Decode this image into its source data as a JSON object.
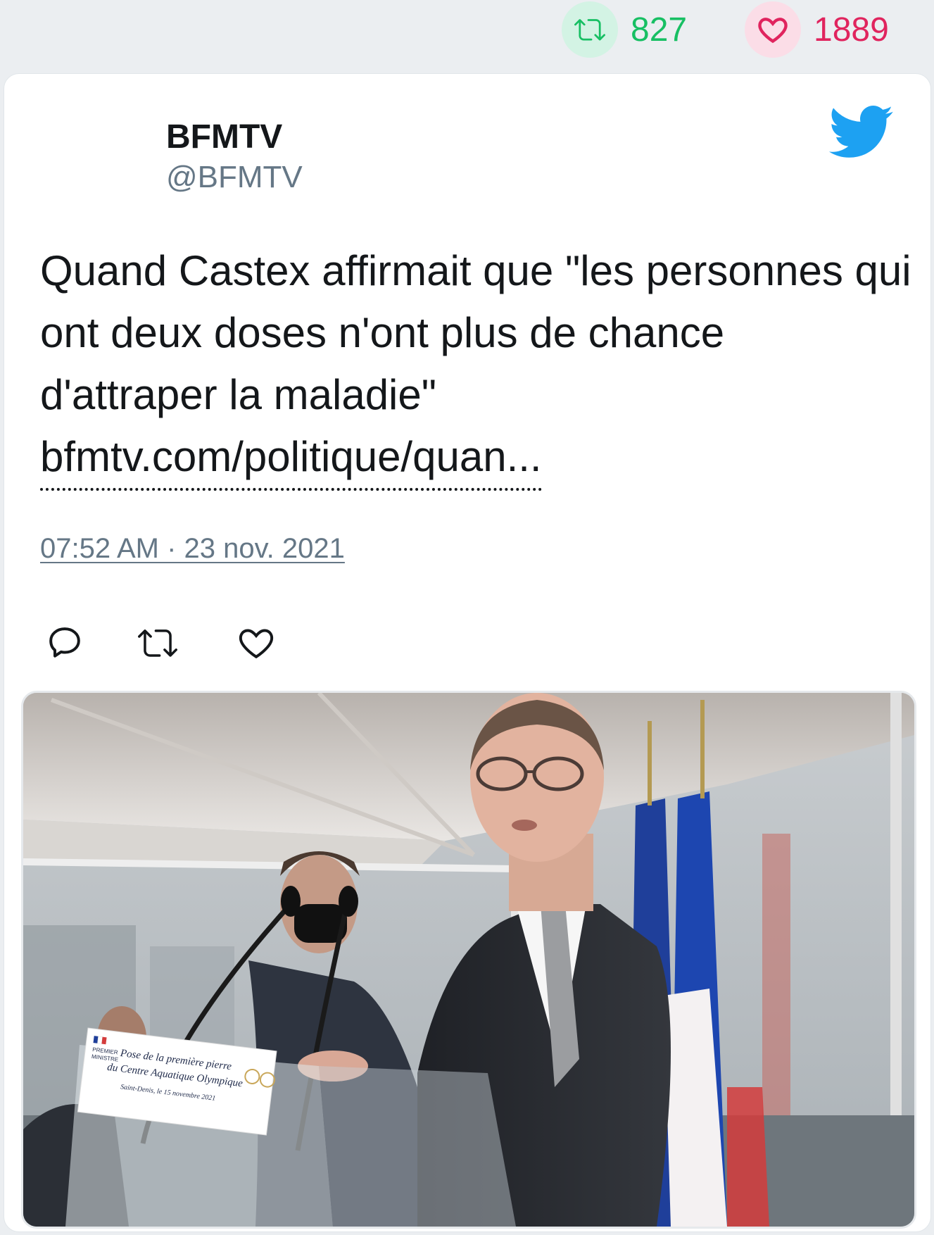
{
  "stats": {
    "retweets": "827",
    "likes": "1889",
    "retweet_icon": "retweet-icon",
    "like_icon": "heart-icon",
    "retweet_color": "#17bf63",
    "like_color": "#e0245e"
  },
  "author": {
    "name": "BFMTV",
    "handle": "@BFMTV"
  },
  "tweet": {
    "text": "Quand Castex affirmait que \"les personnes qui ont deux doses n'ont plus de chance d'attraper la maladie\"",
    "link": "bfmtv.com/politique/quan...",
    "timestamp": "07:52 AM · 23 nov. 2021"
  },
  "brand": {
    "twitter_blue": "#1da1f2"
  },
  "photo": {
    "sign": {
      "org_line1": "PREMIER",
      "org_line2": "MINISTRE",
      "line1": "Pose de la première pierre",
      "line2": "du Centre Aquatique Olympique",
      "line3": "Saint-Denis, le 15 novembre 2021"
    }
  }
}
